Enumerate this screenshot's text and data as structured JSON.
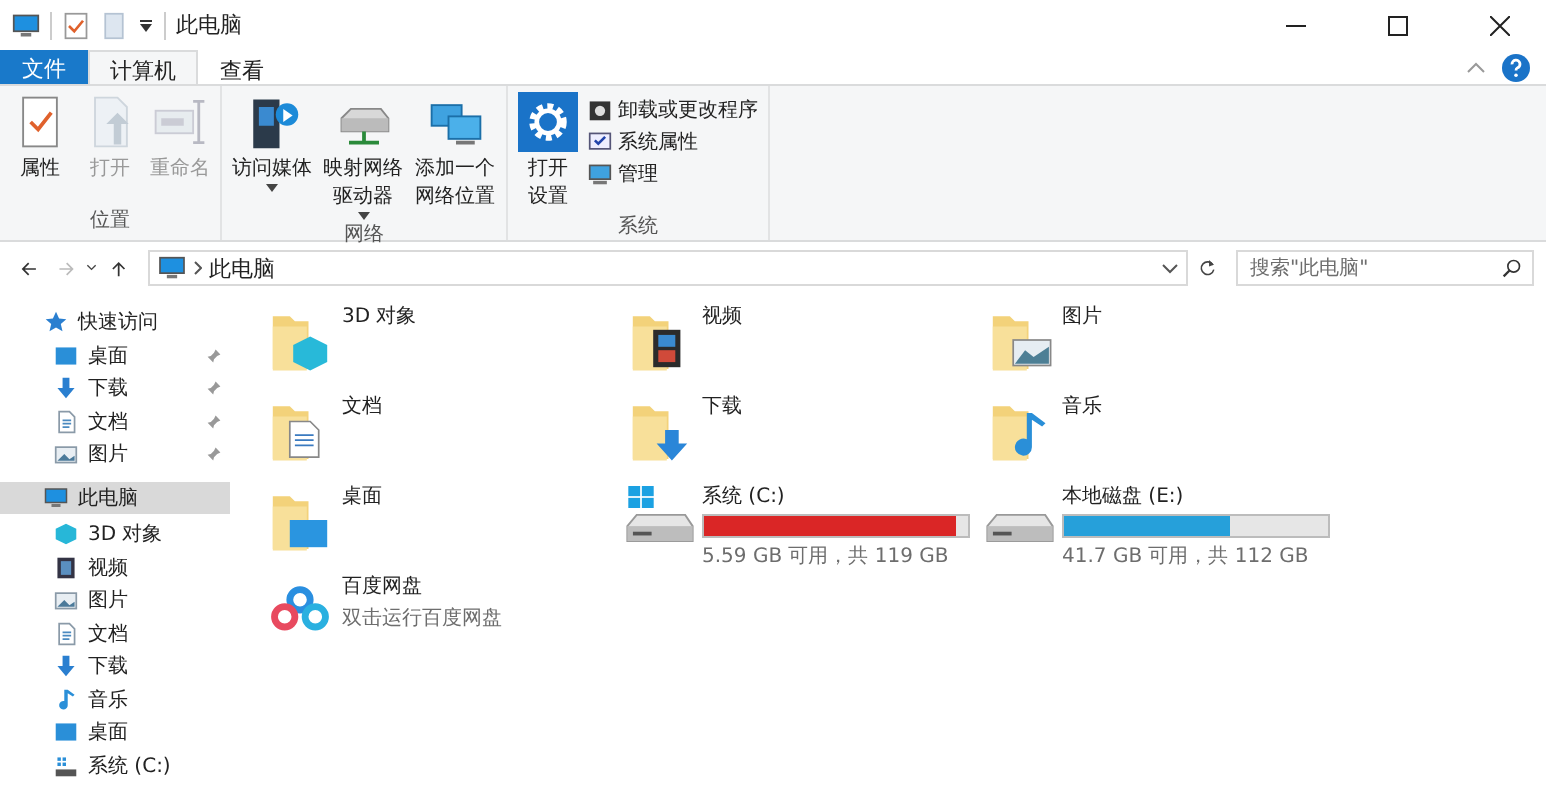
{
  "window": {
    "title": "此电脑"
  },
  "ribbon_tabs": [
    {
      "label": "文件",
      "kind": "file",
      "selected": false
    },
    {
      "label": "计算机",
      "kind": "tab",
      "selected": true
    },
    {
      "label": "查看",
      "kind": "tab",
      "selected": false
    }
  ],
  "ribbon_groups": [
    {
      "label": "位置",
      "items": [
        {
          "label": "属性",
          "kind": "properties",
          "disabled": false
        },
        {
          "label": "打开",
          "kind": "open",
          "disabled": true
        },
        {
          "label": "重命名",
          "kind": "rename",
          "disabled": true
        }
      ]
    },
    {
      "label": "网络",
      "items": [
        {
          "label": "访问媒体",
          "kind": "media",
          "disabled": false,
          "dropdown": true
        },
        {
          "label": "映射网络驱动器",
          "kind": "netdrive",
          "disabled": false,
          "dropdown": true
        },
        {
          "label": "添加一个网络位置",
          "kind": "netplace",
          "disabled": false
        }
      ]
    },
    {
      "label": "系统",
      "items": [
        {
          "label": "打开设置",
          "kind": "settings",
          "disabled": false
        }
      ],
      "small_items": [
        {
          "label": "卸载或更改程序",
          "kind": "uninstall"
        },
        {
          "label": "系统属性",
          "kind": "sysprops"
        },
        {
          "label": "管理",
          "kind": "manage"
        }
      ]
    }
  ],
  "address_bar": {
    "path": "此电脑",
    "forward_disabled": true
  },
  "search": {
    "placeholder": "搜索\"此电脑\""
  },
  "sidebar": [
    {
      "label": "快速访问",
      "kind": "star",
      "selected": false,
      "children": [
        {
          "label": "桌面",
          "kind": "desktop",
          "pinned": true
        },
        {
          "label": "下载",
          "kind": "downloads",
          "pinned": true
        },
        {
          "label": "文档",
          "kind": "documents",
          "pinned": true
        },
        {
          "label": "图片",
          "kind": "pictures",
          "pinned": true
        }
      ]
    },
    {
      "label": "此电脑",
      "kind": "pc",
      "selected": true,
      "children": [
        {
          "label": "3D 对象",
          "kind": "objects",
          "pinned": false
        },
        {
          "label": "视频",
          "kind": "video",
          "pinned": false
        },
        {
          "label": "图片",
          "kind": "pictures",
          "pinned": false
        },
        {
          "label": "文档",
          "kind": "documents",
          "pinned": false
        },
        {
          "label": "下载",
          "kind": "downloads",
          "pinned": false
        },
        {
          "label": "音乐",
          "kind": "music",
          "pinned": false
        },
        {
          "label": "桌面",
          "kind": "desktop",
          "pinned": false
        },
        {
          "label": "系统 (C:)",
          "kind": "drive",
          "pinned": false
        }
      ]
    }
  ],
  "items": [
    {
      "name": "3D 对象",
      "kind": "objects"
    },
    {
      "name": "视频",
      "kind": "video"
    },
    {
      "name": "图片",
      "kind": "pictures"
    },
    {
      "name": "文档",
      "kind": "documents"
    },
    {
      "name": "下载",
      "kind": "downloads"
    },
    {
      "name": "音乐",
      "kind": "music"
    },
    {
      "name": "桌面",
      "kind": "desktop"
    },
    {
      "name": "系统 (C:)",
      "kind": "drive",
      "windows": true,
      "level": 0.953,
      "space": "5.59 GB 可用，共 119 GB"
    },
    {
      "name": "本地磁盘 (E:)",
      "kind": "drive",
      "windows": false,
      "level": 0.628,
      "space": "41.7 GB 可用，共 112 GB"
    },
    {
      "name": "百度网盘",
      "kind": "app",
      "subtitle": "双击运行百度网盘"
    }
  ]
}
